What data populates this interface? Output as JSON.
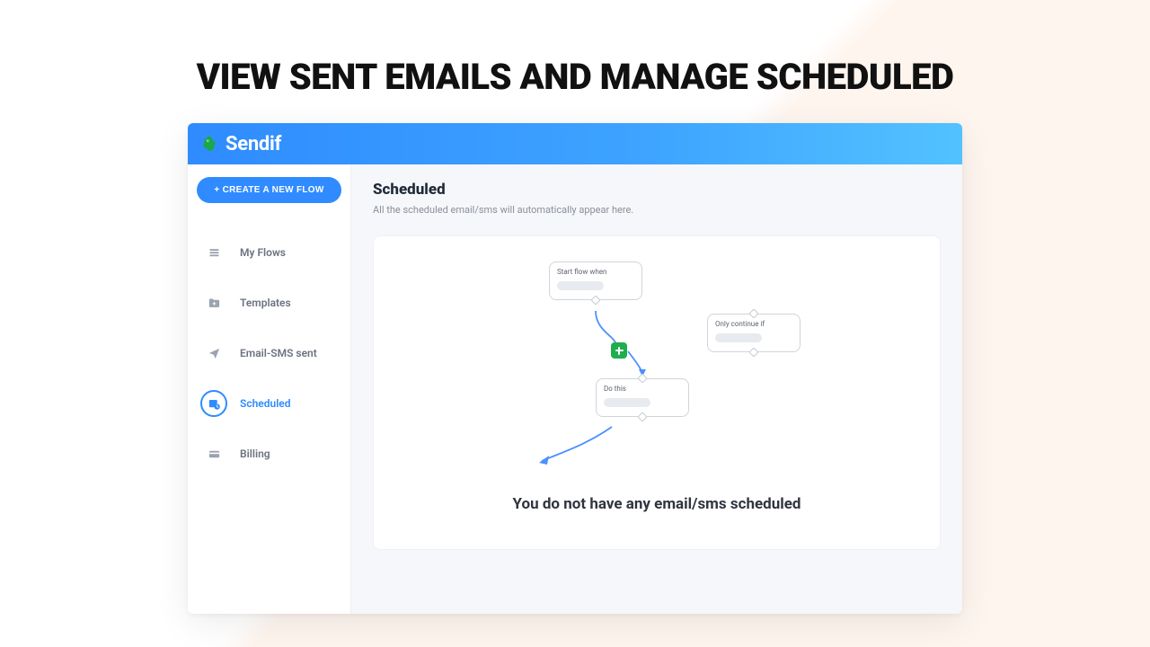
{
  "headline": "VIEW SENT EMAILS AND MANAGE SCHEDULED",
  "brand": "Sendif",
  "sidebar": {
    "create_btn": "+ CREATE A NEW FLOW",
    "items": [
      {
        "label": "My Flows"
      },
      {
        "label": "Templates"
      },
      {
        "label": "Email-SMS sent"
      },
      {
        "label": "Scheduled"
      },
      {
        "label": "Billing"
      }
    ],
    "active_index": 3
  },
  "main": {
    "title": "Scheduled",
    "subtitle": "All the scheduled email/sms will automatically appear here.",
    "empty_message": "You do not have any email/sms scheduled",
    "illustration": {
      "node1_label": "Start flow when",
      "node2_label": "Only continue if",
      "node3_label": "Do this"
    }
  }
}
